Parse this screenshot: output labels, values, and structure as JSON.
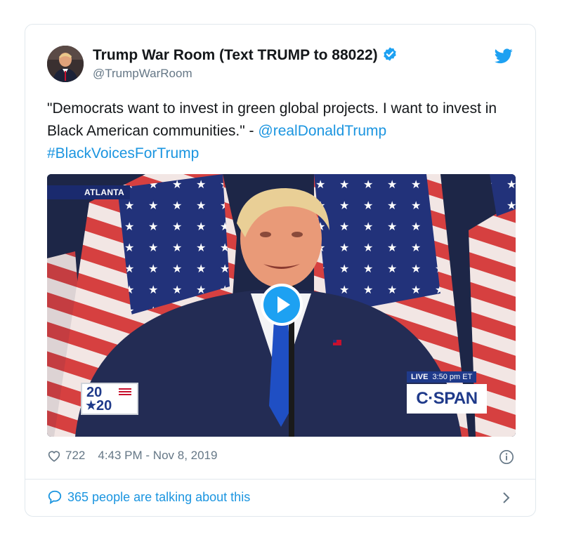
{
  "tweet": {
    "author_name": "Trump War Room (Text TRUMP to 88022)",
    "author_handle": "@TrumpWarRoom",
    "text_quote": "\"Democrats want to invest in green global projects. I want to invest in Black American communities.\" - ",
    "mention": "@realDonaldTrump",
    "hashtag": "#BlackVoicesForTrump",
    "likes": "722",
    "timestamp": "4:43 PM - Nov 8, 2019",
    "talking": "365 people are talking about this"
  },
  "media": {
    "location_banner": "ATLANTA",
    "logo_top": "20",
    "logo_bottom": "20",
    "live_label": "LIVE",
    "live_time": "3:50 pm ET",
    "network": "C·SPAN"
  },
  "colors": {
    "link_blue": "#1b95e0",
    "twitter_blue": "#1da1f2",
    "meta_gray": "#657786",
    "border": "#e1e8ed"
  },
  "icons": [
    "verified-badge-icon",
    "twitter-bird-icon",
    "play-icon",
    "heart-icon",
    "info-icon",
    "speech-bubble-icon",
    "chevron-right-icon"
  ]
}
